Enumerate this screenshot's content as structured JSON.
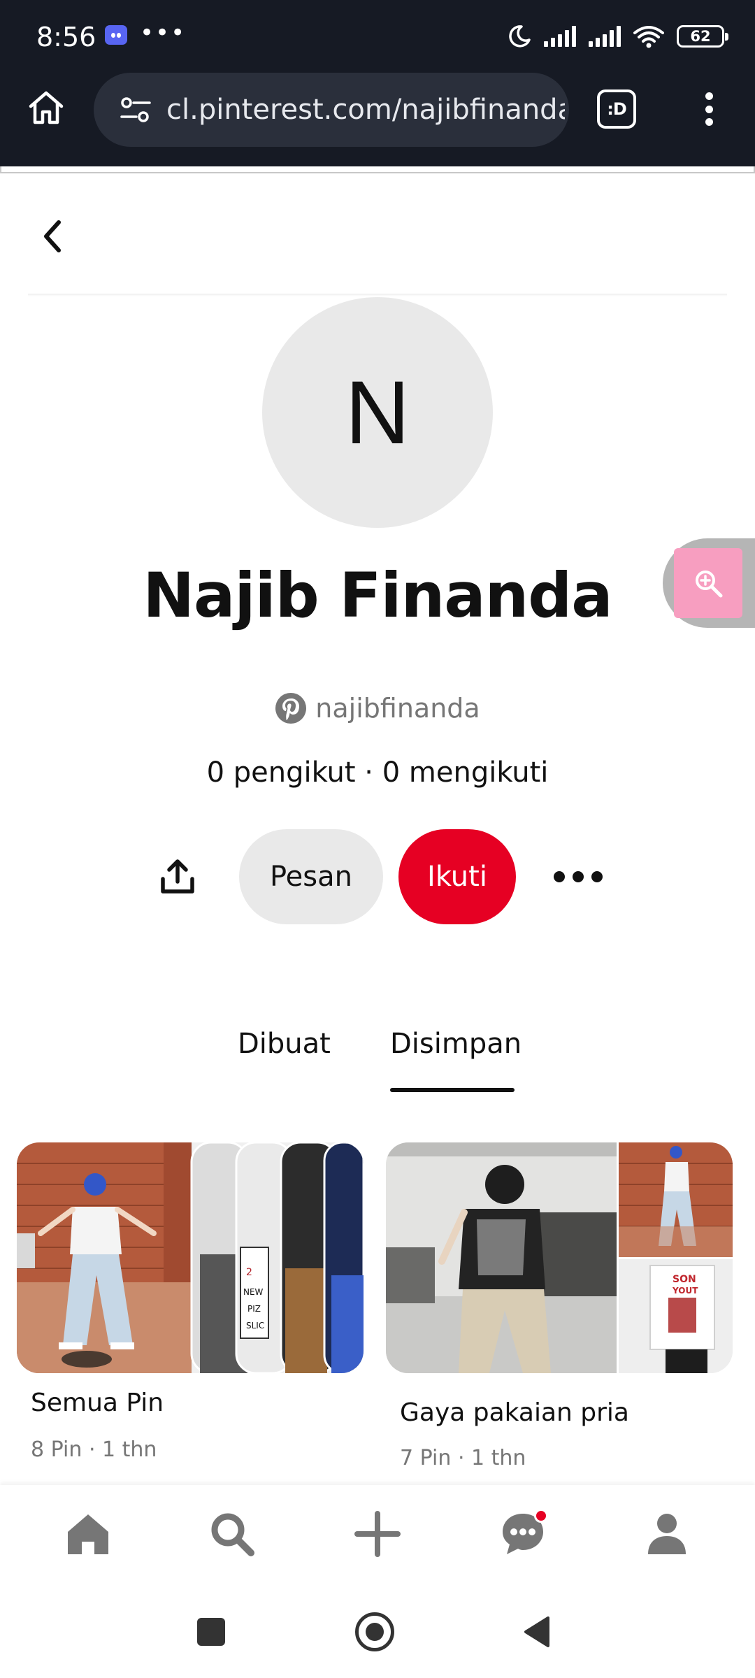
{
  "status_bar": {
    "time": "8:56",
    "notification_more": "•••",
    "battery_level": "62",
    "icons": [
      "discord-icon",
      "do-not-disturb-icon",
      "signal-icon",
      "signal-icon",
      "wifi-icon",
      "battery-icon"
    ]
  },
  "browser": {
    "url": "cl.pinterest.com/najibfinanda",
    "extension_label": ":D",
    "icons": [
      "home-icon",
      "site-settings-icon",
      "extension-icon",
      "overflow-menu-icon"
    ]
  },
  "profile": {
    "avatar_letter": "N",
    "name": "Najib Finanda",
    "username": "najibfinanda",
    "follow_stats": "0 pengikut · 0 mengikuti",
    "buttons": {
      "message": "Pesan",
      "follow": "Ikuti"
    }
  },
  "tabs": {
    "created": "Dibuat",
    "saved": "Disimpan",
    "active": "saved"
  },
  "boards": [
    {
      "title": "Semua Pin",
      "meta": "8 Pin · 1 thn"
    },
    {
      "title": "Gaya pakaian pria",
      "meta": "7 Pin · 1 thn"
    }
  ],
  "bottom_nav": {
    "items": [
      "home-icon",
      "search-icon",
      "plus-icon",
      "messages-icon",
      "profile-icon"
    ],
    "messages_has_badge": true
  },
  "colors": {
    "brand_red": "#e60023",
    "chrome_bg": "#161a24",
    "url_bar_bg": "#2a2f3b",
    "secondary_button_bg": "#e9e9e9",
    "muted_text": "#767676",
    "zoom_button_pink": "#f79ec0"
  }
}
